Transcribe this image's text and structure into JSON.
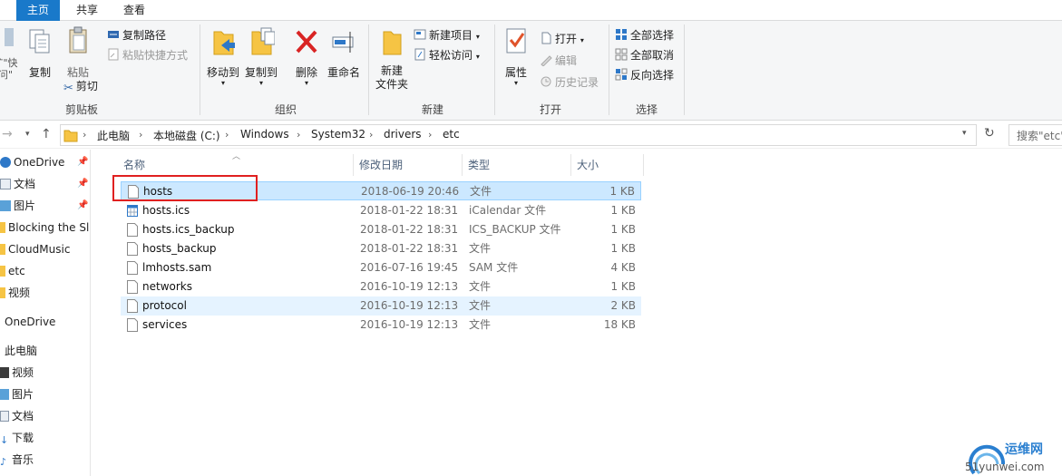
{
  "menu": {
    "tabs": [
      {
        "label": "主页"
      },
      {
        "label": "共享"
      },
      {
        "label": "查看"
      }
    ]
  },
  "ribbon": {
    "clipboard": {
      "partial_label_1": "扩\"快",
      "partial_label_2": "问\"",
      "copy": "复制",
      "paste": "粘贴",
      "copy_path": "复制路径",
      "paste_shortcut": "粘贴快捷方式",
      "cut": "剪切",
      "group": "剪贴板"
    },
    "organize": {
      "move_to": "移动到",
      "copy_to": "复制到",
      "delete": "删除",
      "rename": "重命名",
      "group": "组织"
    },
    "new": {
      "new_folder_1": "新建",
      "new_folder_2": "文件夹",
      "new_item": "新建项目",
      "easy_access": "轻松访问",
      "group": "新建"
    },
    "open": {
      "properties": "属性",
      "open": "打开",
      "edit": "编辑",
      "history": "历史记录",
      "group": "打开"
    },
    "select": {
      "select_all": "全部选择",
      "select_none": "全部取消",
      "invert": "反向选择",
      "group": "选择"
    }
  },
  "address": {
    "crumbs": [
      "此电脑",
      "本地磁盘 (C:)",
      "Windows",
      "System32",
      "drivers",
      "etc"
    ],
    "search_placeholder": "搜索\"etc\""
  },
  "nav": {
    "items": [
      {
        "label": "OneDrive",
        "pinned": true
      },
      {
        "label": "文档",
        "pinned": true
      },
      {
        "label": "图片",
        "pinned": true
      },
      {
        "label": "Blocking the Sl"
      },
      {
        "label": "CloudMusic"
      },
      {
        "label": "etc"
      },
      {
        "label": "视频"
      },
      {
        "label": "OneDrive"
      },
      {
        "label": "此电脑"
      },
      {
        "label": "视频"
      },
      {
        "label": "图片"
      },
      {
        "label": "文档"
      },
      {
        "label": "下载"
      },
      {
        "label": "音乐"
      }
    ]
  },
  "list": {
    "columns": {
      "name": "名称",
      "date": "修改日期",
      "type": "类型",
      "size": "大小"
    },
    "rows": [
      {
        "name": "hosts",
        "date": "2018-06-19 20:46",
        "type": "文件",
        "size": "1 KB"
      },
      {
        "name": "hosts.ics",
        "date": "2018-01-22 18:31",
        "type": "iCalendar 文件",
        "size": "1 KB"
      },
      {
        "name": "hosts.ics_backup",
        "date": "2018-01-22 18:31",
        "type": "ICS_BACKUP 文件",
        "size": "1 KB"
      },
      {
        "name": "hosts_backup",
        "date": "2018-01-22 18:31",
        "type": "文件",
        "size": "1 KB"
      },
      {
        "name": "lmhosts.sam",
        "date": "2016-07-16 19:45",
        "type": "SAM 文件",
        "size": "4 KB"
      },
      {
        "name": "networks",
        "date": "2016-10-19 12:13",
        "type": "文件",
        "size": "1 KB"
      },
      {
        "name": "protocol",
        "date": "2016-10-19 12:13",
        "type": "文件",
        "size": "2 KB"
      },
      {
        "name": "services",
        "date": "2016-10-19 12:13",
        "type": "文件",
        "size": "18 KB"
      }
    ]
  },
  "watermark": {
    "text": "运维网",
    "sub": "51yunwei.com"
  },
  "colors": {
    "accent": "#1979ca",
    "selection": "#cce8ff",
    "highlight_box": "#e02020"
  }
}
